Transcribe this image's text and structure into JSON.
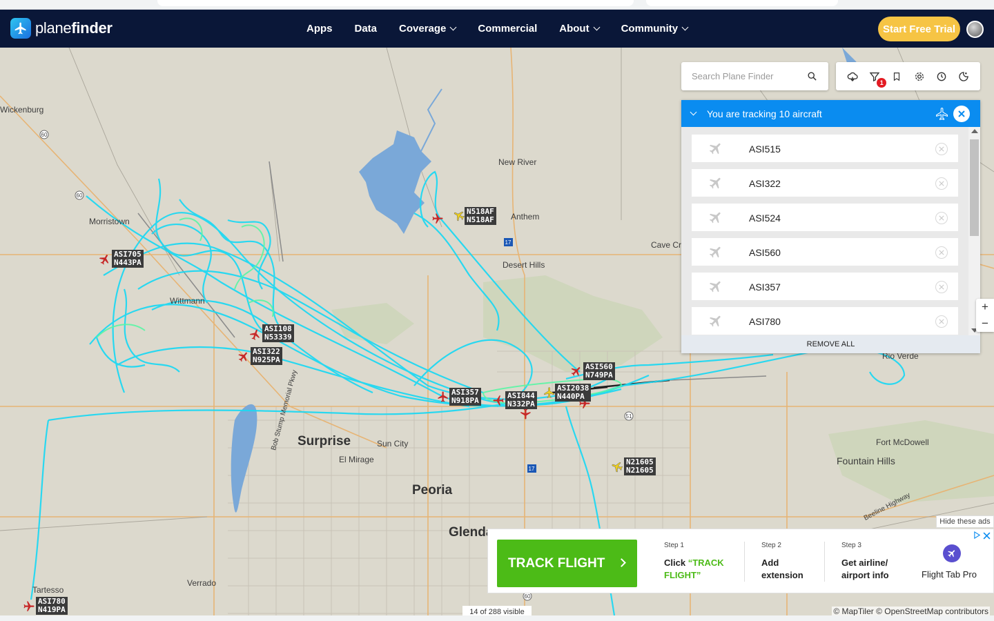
{
  "nav": {
    "logo_prefix": "plane",
    "logo_suffix": "finder",
    "menu": [
      {
        "label": "Apps",
        "dropdown": false
      },
      {
        "label": "Data",
        "dropdown": false
      },
      {
        "label": "Coverage",
        "dropdown": true
      },
      {
        "label": "Commercial",
        "dropdown": false
      },
      {
        "label": "About",
        "dropdown": true
      },
      {
        "label": "Community",
        "dropdown": true
      }
    ],
    "cta": "Start Free Trial",
    "cta_color": "#f6c444",
    "bg_color": "#0a1738"
  },
  "search": {
    "placeholder": "Search Plane Finder",
    "icon": "search-icon"
  },
  "toolbar": {
    "icons": [
      "cloud-layers-icon",
      "filter-icon",
      "bookmark-icon",
      "settings-icon",
      "history-icon",
      "theme-icon"
    ],
    "filter_badge": "1"
  },
  "tracking": {
    "title": "You are tracking 10 aircraft",
    "header_color": "#0a8cf0",
    "aircraft": [
      "ASI515",
      "ASI322",
      "ASI524",
      "ASI560",
      "ASI357",
      "ASI780"
    ],
    "remove_all": "REMOVE ALL"
  },
  "map": {
    "places": [
      {
        "name": "Wickenburg",
        "big": false
      },
      {
        "name": "Morristown",
        "big": false
      },
      {
        "name": "Wittmann",
        "big": false
      },
      {
        "name": "New River",
        "big": false
      },
      {
        "name": "Anthem",
        "big": false
      },
      {
        "name": "Desert Hills",
        "big": false
      },
      {
        "name": "Cave Cre",
        "big": false
      },
      {
        "name": "Rio Verde",
        "big": false
      },
      {
        "name": "Surprise",
        "big": true
      },
      {
        "name": "Sun City",
        "big": false
      },
      {
        "name": "El Mirage",
        "big": false
      },
      {
        "name": "Peoria",
        "big": true
      },
      {
        "name": "Glenda",
        "big": true
      },
      {
        "name": "Fort McDowell",
        "big": false
      },
      {
        "name": "Fountain Hills",
        "big": false
      },
      {
        "name": "Verrado",
        "big": false
      },
      {
        "name": "Tartesso",
        "big": false
      },
      {
        "name": "Beeline Highway",
        "big": false
      },
      {
        "name": "Bob Stump Memorial Pkwy",
        "big": false
      }
    ],
    "route_shields": [
      "60",
      "60",
      "17",
      "17",
      "51",
      "60"
    ],
    "aircraft": [
      {
        "callsign": "N518AF",
        "reg": "N518AF",
        "color": "yellow"
      },
      {
        "callsign": "ASI705",
        "reg": "N443PA",
        "color": "red"
      },
      {
        "callsign": "ASI108",
        "reg": "N53339",
        "color": "red"
      },
      {
        "callsign": "ASI322",
        "reg": "N925PA",
        "color": "red"
      },
      {
        "callsign": "ASI560",
        "reg": "N749PA",
        "color": "red"
      },
      {
        "callsign": "ASI357",
        "reg": "N918PA",
        "color": "red"
      },
      {
        "callsign": "ASI844",
        "reg": "N332PA",
        "color": "red"
      },
      {
        "callsign": "ASI2038",
        "reg": "N440PA",
        "color": "yellow"
      },
      {
        "callsign": "N21605",
        "reg": "N21605",
        "color": "yellow"
      },
      {
        "callsign": "ASI780",
        "reg": "N419PA",
        "color": "red"
      }
    ],
    "track_color": "#1fd8f2",
    "visible_count": "14 of 288 visible",
    "attribution": "© MapTiler © OpenStreetMap contributors"
  },
  "zoom": {
    "in": "+",
    "out": "−"
  },
  "ad": {
    "hide_label": "Hide these ads",
    "cta": "TRACK FLIGHT",
    "steps": [
      {
        "label": "Step 1",
        "text_prefix": "Click ",
        "text_highlight": "“TRACK FLIGHT”"
      },
      {
        "label": "Step 2",
        "text": "Add extension"
      },
      {
        "label": "Step 3",
        "text": "Get airline/ airport info"
      }
    ],
    "brand": "Flight Tab Pro",
    "cta_color": "#4cbb17"
  }
}
